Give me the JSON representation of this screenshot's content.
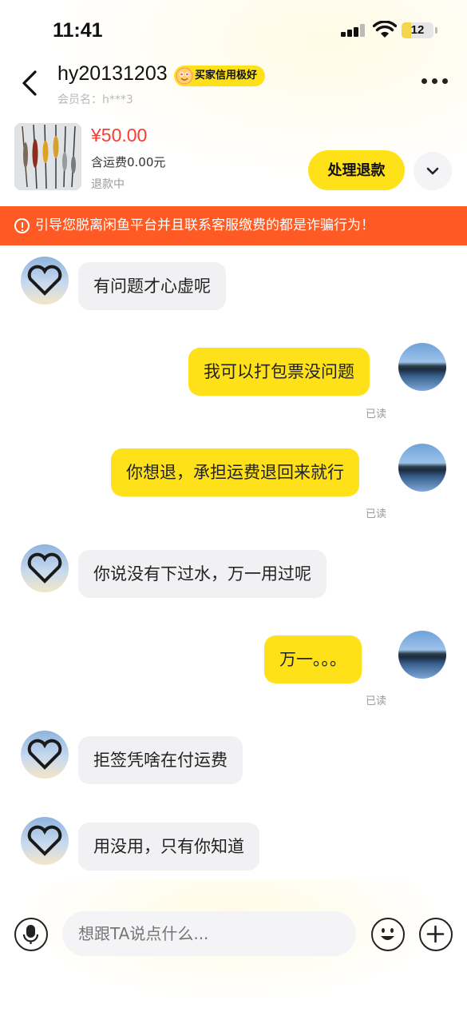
{
  "status_bar": {
    "time": "11:41",
    "battery": "12"
  },
  "header": {
    "username": "hy20131203",
    "credit_badge": "买家信用极好",
    "member_name": "会员名：h***3"
  },
  "product": {
    "price": "¥50.00",
    "shipping": "含运费0.00元",
    "status": "退款中",
    "action_label": "处理退款"
  },
  "warning": "引导您脱离闲鱼平台并且联系客服缴费的都是诈骗行为！",
  "messages": [
    {
      "side": "in",
      "text": "有问题才心虚呢"
    },
    {
      "side": "out",
      "text": "我可以打包票没问题",
      "read": "已读"
    },
    {
      "side": "out",
      "text": "你想退，承担运费退回来就行",
      "read": "已读"
    },
    {
      "side": "in",
      "text": "你说没有下过水，万一用过呢"
    },
    {
      "side": "out",
      "text": "万一。。。",
      "read": "已读"
    },
    {
      "side": "in",
      "text": "拒签凭啥在付运费"
    },
    {
      "side": "in",
      "text": "用没用，只有你知道"
    }
  ],
  "input": {
    "placeholder": "想跟TA说点什么..."
  },
  "colors": {
    "accent_yellow": "#ffe11a",
    "warning_orange": "#ff5a23",
    "price_red": "#ff3b30"
  }
}
